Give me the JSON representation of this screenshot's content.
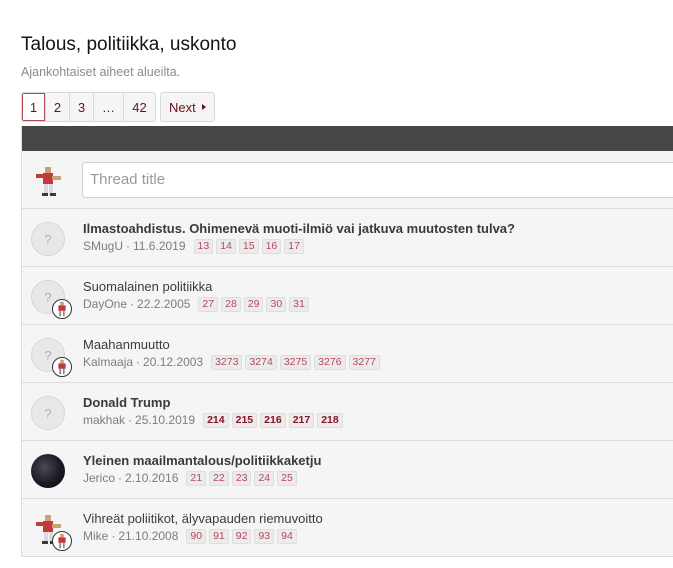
{
  "forum": {
    "title": "Talous, politiikka, uskonto",
    "description": "Ajankohtaiset aiheet alueilta."
  },
  "pagination": {
    "pages": [
      "1",
      "2",
      "3",
      "…",
      "42"
    ],
    "current": "1",
    "next_label": "Next"
  },
  "new_thread": {
    "placeholder": "Thread title"
  },
  "threads": [
    {
      "title": "Ilmastoahdistus. Ohimenevä muoti-ilmiö vai jatkuva muutosten tulva?",
      "author": "SMugU",
      "date": "11.6.2019",
      "pages": [
        "13",
        "14",
        "15",
        "16",
        "17"
      ],
      "unread": true,
      "avatar": "placeholder"
    },
    {
      "title": "Suomalainen politiikka",
      "author": "DayOne",
      "date": "22.2.2005",
      "pages": [
        "27",
        "28",
        "29",
        "30",
        "31"
      ],
      "unread": false,
      "avatar": "placeholder-with-mini"
    },
    {
      "title": "Maahanmuutto",
      "author": "Kalmaaja",
      "date": "20.12.2003",
      "pages": [
        "3273",
        "3274",
        "3275",
        "3276",
        "3277"
      ],
      "unread": false,
      "avatar": "placeholder-with-mini"
    },
    {
      "title": "Donald Trump",
      "author": "makhak",
      "date": "25.10.2019",
      "pages": [
        "214",
        "215",
        "216",
        "217",
        "218"
      ],
      "unread": true,
      "avatar": "placeholder"
    },
    {
      "title": "Yleinen maailmantalous/politiikkaketju",
      "author": "Jerico",
      "date": "2.10.2016",
      "pages": [
        "21",
        "22",
        "23",
        "24",
        "25"
      ],
      "unread": true,
      "avatar": "dark"
    },
    {
      "title": "Vihreät poliitikot, älyvapauden riemuvoitto",
      "author": "Mike",
      "date": "21.10.2008",
      "pages": [
        "90",
        "91",
        "92",
        "93",
        "94"
      ],
      "unread": false,
      "avatar": "figure-with-mini"
    }
  ],
  "icons": {
    "placeholder_glyph": "?",
    "next_caret": "caret-right-icon",
    "user_figure": "fighter-figure-icon"
  },
  "colors": {
    "accent": "#6e0d1a",
    "header_bar": "#464646",
    "row_bg": "#f5f5f5"
  }
}
